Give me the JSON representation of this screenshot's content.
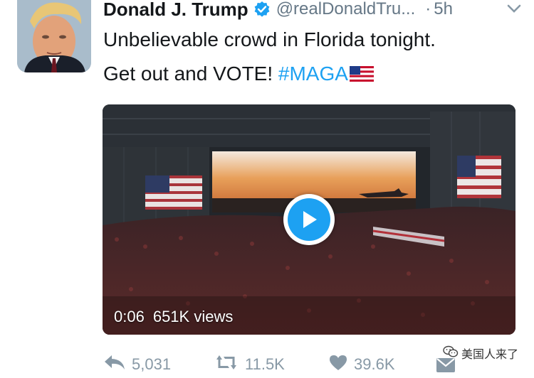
{
  "tweet": {
    "display_name": "Donald J. Trump",
    "handle": "@realDonaldTru...",
    "separator": "·",
    "time": "5h",
    "text_line1": "Unbelievable crowd in Florida tonight.",
    "text_line2": "Get out and VOTE! ",
    "hashtag": "#MAGA",
    "emoji": "us-flag-emoji"
  },
  "video": {
    "duration": "0:06",
    "views": "651K views"
  },
  "actions": {
    "replies": "5,031",
    "retweets": "11.5K",
    "likes": "39.6K"
  },
  "watermark": {
    "text": "美国人来了"
  },
  "colors": {
    "link": "#1da1f2",
    "muted": "#657786",
    "action_gray": "#8899a6",
    "verified": "#1da1f2"
  },
  "icons": [
    "verified-badge-icon",
    "chevron-down-icon",
    "play-icon",
    "reply-icon",
    "retweet-icon",
    "heart-icon",
    "direct-message-icon",
    "wechat-icon"
  ]
}
